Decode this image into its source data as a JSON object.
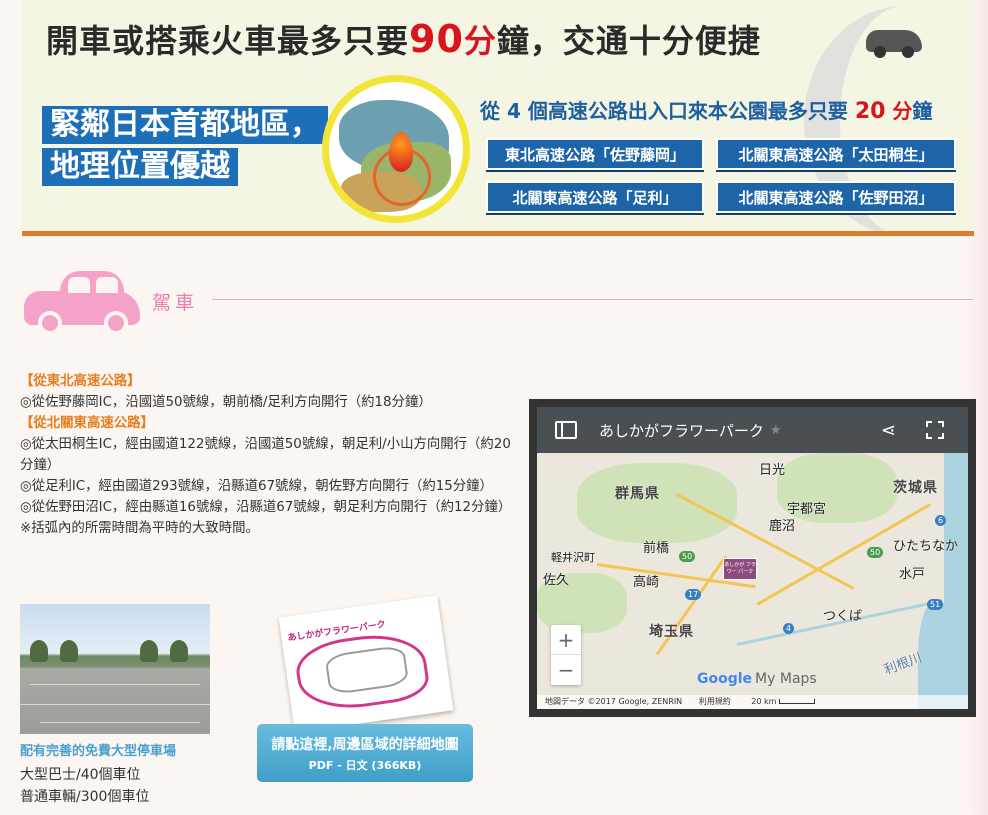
{
  "banner": {
    "headline_pre": "開車或搭乘火車最多只要",
    "headline_num": "90",
    "headline_unit": "分",
    "headline_post": "鐘，交通十分便捷",
    "tagline_1": "緊鄰日本首都地區，",
    "tagline_2": "地理位置優越",
    "hw_title_pre": "從",
    "hw_title_num": "4",
    "hw_title_mid": "個高速公路出入口來本公園最多只要",
    "hw_title_num2": "20",
    "hw_title_unit": "分",
    "hw_title_post": "鐘",
    "exits": [
      "東北高速公路「佐野藤岡」",
      "北關東高速公路「太田桐生」",
      "北關東高速公路「足利」",
      "北關東高速公路「佐野田沼」"
    ]
  },
  "section": {
    "title": "駕車"
  },
  "directions": {
    "h1": "【從東北高速公路】",
    "l1": "◎從佐野藤岡IC，沿國道50號線，朝前橋/足利方向開行（約18分鐘）",
    "h2": "【從北關東高速公路】",
    "l2": "◎從太田桐生IC，經由國道122號線，沿國道50號線，朝足利/小山方向開行（約20分鐘）",
    "l3": "◎從足利IC，經由國道293號線，沿縣道67號線，朝佐野方向開行（約15分鐘）",
    "l4": "◎從佐野田沼IC，經由縣道16號線，沿縣道67號線，朝足利方向開行（約12分鐘）",
    "note": "※括弧內的所需時間為平時的大致時間。"
  },
  "parking": {
    "caption": "配有完善的免費大型停車場",
    "bus": "大型巴士/40個車位",
    "car": "普通車輛/300個車位"
  },
  "pdf": {
    "thumb_title": "あしかがフラワーパーク",
    "label": "請點這裡,周邊區域的詳細地圖",
    "sub": "PDF - 日文 (366KB)"
  },
  "map": {
    "title": "あしかがフラワーパーク",
    "labels": {
      "gunma": "群馬県",
      "ibaraki": "茨城県",
      "saitama": "埼玉県",
      "nikko": "日光",
      "utsunomiya": "宇都宮",
      "kanuma": "鹿沼",
      "maebashi": "前橋",
      "takasaki": "高崎",
      "karuizawa": "軽井沢町",
      "saku": "佐久",
      "hitachinaka": "ひたちなか",
      "mito": "水戸",
      "tsukuba": "つくば",
      "tone": "利根川"
    },
    "routes": [
      "50",
      "50",
      "17",
      "4",
      "6",
      "51"
    ],
    "zoom_in": "+",
    "zoom_out": "−",
    "google": "Google",
    "mymaps": "My Maps",
    "attribution": "地図データ ©2017 Google, ZENRIN",
    "terms": "利用規約",
    "scale": "20 km",
    "marker_text": "あしかが フラワー パーク"
  }
}
